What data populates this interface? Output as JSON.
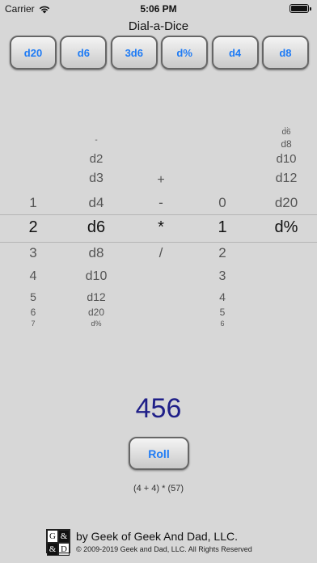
{
  "status_bar": {
    "carrier": "Carrier",
    "time": "5:06 PM"
  },
  "app": {
    "title": "Dial-a-Dice"
  },
  "presets": [
    "d20",
    "d6",
    "3d6",
    "d%",
    "d4",
    "d8"
  ],
  "picker": {
    "columns": [
      {
        "name": "count",
        "above": [
          "",
          "",
          "",
          "1"
        ],
        "selected": "2",
        "below": [
          "3",
          "4",
          "5",
          "6",
          "7"
        ]
      },
      {
        "name": "die",
        "above": [
          "-",
          "d2",
          "d3",
          "d4"
        ],
        "selected": "d6",
        "below": [
          "d8",
          "d10",
          "d12",
          "d20",
          "d%"
        ]
      },
      {
        "name": "operator",
        "above": [
          "",
          "",
          "+",
          "-"
        ],
        "selected": "*",
        "below": [
          "/",
          "",
          "",
          "",
          ""
        ]
      },
      {
        "name": "modifier",
        "above": [
          "",
          "",
          "",
          "0"
        ],
        "selected": "1",
        "below": [
          "2",
          "3",
          "4",
          "5",
          "6"
        ]
      },
      {
        "name": "modifier-die",
        "above": [
          "d8",
          "d10",
          "d12",
          "d20"
        ],
        "selected": "d%",
        "below": [
          "",
          "",
          "",
          "",
          ""
        ]
      },
      {
        "name": "modifier-die-top",
        "above": [
          "d6"
        ],
        "selected": "",
        "below": []
      }
    ]
  },
  "result": {
    "value": "456"
  },
  "roll_button": {
    "label": "Roll"
  },
  "expression": "(4 + 4) * (57)",
  "footer": {
    "logo_letters": [
      "G",
      "&",
      "&",
      "D"
    ],
    "line1": "by Geek of Geek And Dad, LLC.",
    "line2": "© 2009-2019 Geek and Dad, LLC. All Rights Reserved"
  },
  "colors": {
    "accent": "#1e7bf5",
    "result": "#1f1f88",
    "background": "#d7d7d7"
  }
}
